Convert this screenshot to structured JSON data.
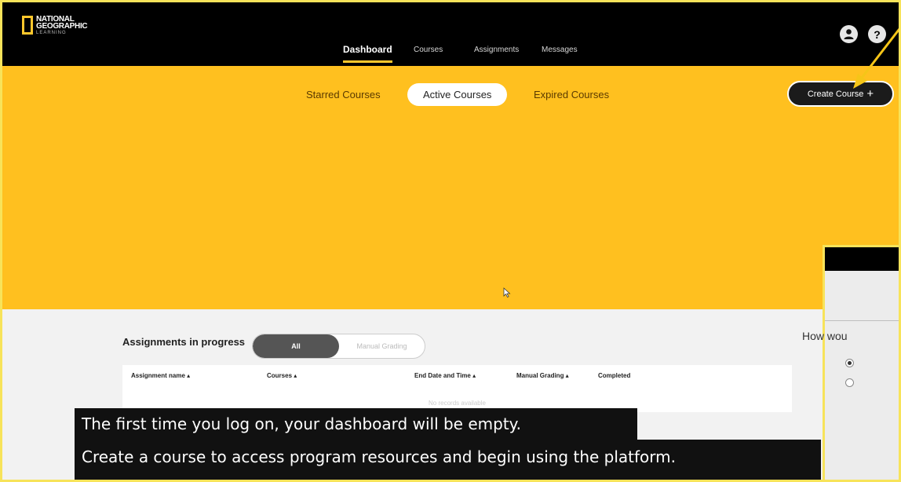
{
  "brand": {
    "line1": "NATIONAL",
    "line2": "GEOGRAPHIC",
    "line3": "LEARNING",
    "accent": "#ffc72c"
  },
  "nav": {
    "items": [
      "Dashboard",
      "Courses",
      "Assignments",
      "Messages"
    ],
    "active": "Dashboard"
  },
  "header_icons": [
    "user-icon",
    "help-icon"
  ],
  "help_glyph": "?",
  "course_tabs": {
    "items": [
      "Starred Courses",
      "Active Courses",
      "Expired Courses"
    ],
    "active": "Active Courses"
  },
  "create_course": {
    "label": "Create Course",
    "icon": "plus-icon",
    "glyph": "+"
  },
  "assignments": {
    "title": "Assignments in progress",
    "filters": [
      "All",
      "Manual Grading"
    ],
    "active_filter": "All",
    "columns": [
      "Assignment name ▴",
      "Courses ▴",
      "End Date and Time ▴",
      "Manual Grading ▴",
      "Completed"
    ],
    "empty_text": "No records available"
  },
  "captions": [
    "The first time you log on, your dashboard will be empty.",
    "Create a course to access program resources and begin using the platform."
  ],
  "dialog": {
    "question": "How wou"
  },
  "colors": {
    "hero_yellow": "#ffc01f",
    "topbar": "#000000",
    "annotation_arrow": "#f5c518"
  }
}
